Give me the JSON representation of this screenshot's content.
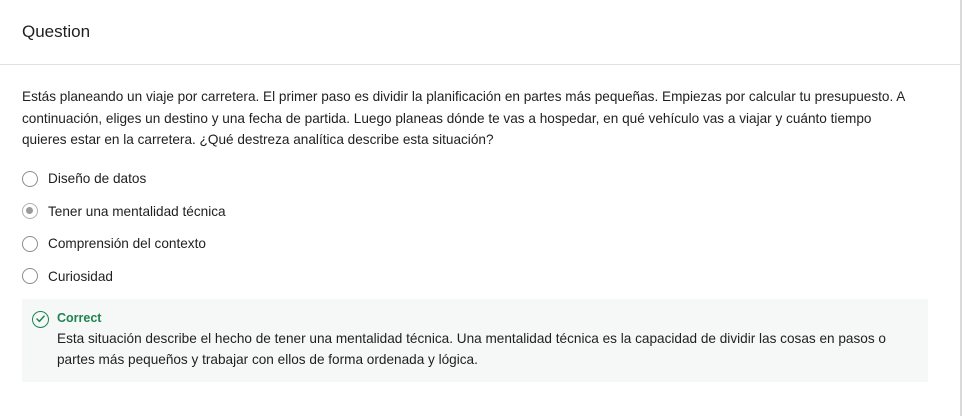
{
  "header": {
    "title": "Question"
  },
  "question": {
    "text": "Estás planeando un viaje por carretera. El primer paso es dividir la planificación en partes más pequeñas. Empiezas por calcular tu presupuesto. A continuación, eliges un destino y una fecha de partida. Luego planeas dónde te vas a hospedar, en qué vehículo vas a viajar y cuánto tiempo quieres estar en la carretera. ¿Qué destreza analítica describe esta situación?",
    "options": [
      {
        "label": "Diseño de datos",
        "selected": false
      },
      {
        "label": "Tener una mentalidad técnica",
        "selected": true
      },
      {
        "label": "Comprensión del contexto",
        "selected": false
      },
      {
        "label": "Curiosidad",
        "selected": false
      }
    ]
  },
  "feedback": {
    "status": "Correct",
    "text": "Esta situación describe el hecho de tener una mentalidad técnica. Una mentalidad técnica es la capacidad de dividir las cosas en pasos o partes más pequeños y trabajar con ellos de forma ordenada y lógica.",
    "icon": "check-circle-icon",
    "color": "#1f8354"
  }
}
